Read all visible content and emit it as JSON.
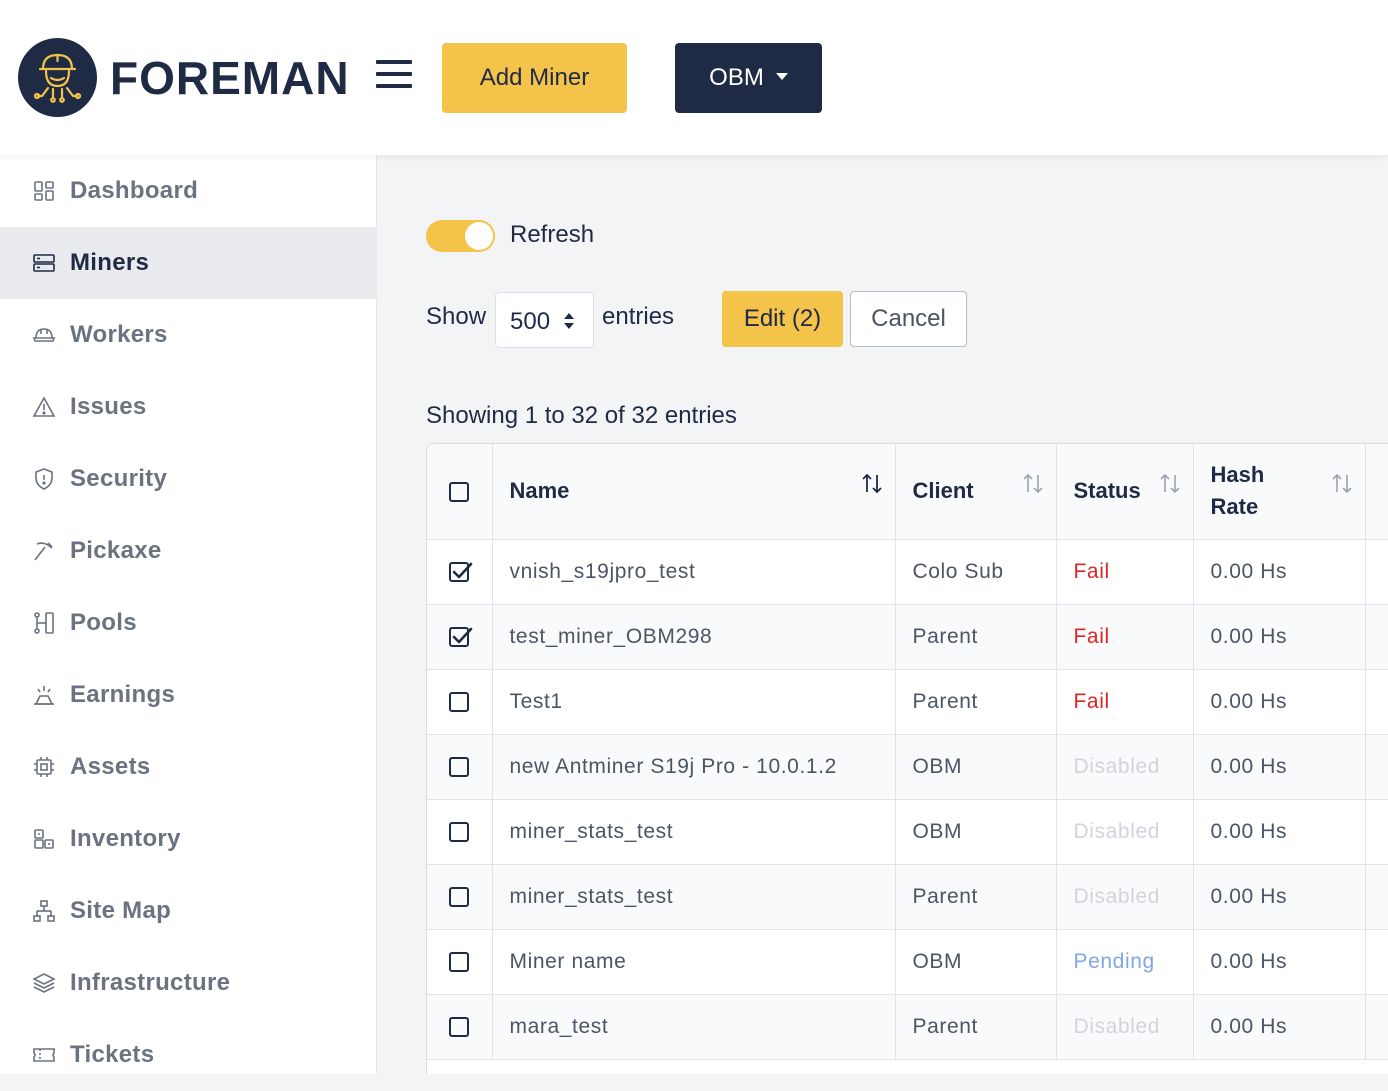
{
  "header": {
    "logo_text": "FOREMAN",
    "add_miner_label": "Add Miner",
    "org_selector_label": "OBM"
  },
  "sidebar": {
    "items": [
      {
        "label": "Dashboard",
        "icon": "dashboard-icon"
      },
      {
        "label": "Miners",
        "icon": "server-icon",
        "active": true
      },
      {
        "label": "Workers",
        "icon": "hardhat-icon"
      },
      {
        "label": "Issues",
        "icon": "warning-icon"
      },
      {
        "label": "Security",
        "icon": "shield-icon"
      },
      {
        "label": "Pickaxe",
        "icon": "pickaxe-icon"
      },
      {
        "label": "Pools",
        "icon": "pools-icon"
      },
      {
        "label": "Earnings",
        "icon": "earnings-icon"
      },
      {
        "label": "Assets",
        "icon": "chip-icon"
      },
      {
        "label": "Inventory",
        "icon": "inventory-icon"
      },
      {
        "label": "Site Map",
        "icon": "sitemap-icon"
      },
      {
        "label": "Infrastructure",
        "icon": "layers-icon"
      },
      {
        "label": "Tickets",
        "icon": "ticket-icon"
      }
    ]
  },
  "controls": {
    "refresh_label": "Refresh",
    "show_label": "Show",
    "entries_value": "500",
    "entries_label": "entries",
    "edit_label": "Edit (2)",
    "cancel_label": "Cancel",
    "showing_text": "Showing 1 to 32 of 32 entries"
  },
  "table": {
    "headers": [
      "Name",
      "Client",
      "Status",
      "Hash Rate"
    ],
    "rows": [
      {
        "checked": true,
        "name": "vnish_s19jpro_test",
        "client": "Colo Sub",
        "status": "Fail",
        "hash_rate": "0.00 Hs"
      },
      {
        "checked": true,
        "name": "test_miner_OBM298",
        "client": "Parent",
        "status": "Fail",
        "hash_rate": "0.00 Hs"
      },
      {
        "checked": false,
        "name": "Test1",
        "client": "Parent",
        "status": "Fail",
        "hash_rate": "0.00 Hs"
      },
      {
        "checked": false,
        "name": "new Antminer S19j Pro - 10.0.1.2",
        "client": "OBM",
        "status": "Disabled",
        "hash_rate": "0.00 Hs"
      },
      {
        "checked": false,
        "name": "miner_stats_test",
        "client": "OBM",
        "status": "Disabled",
        "hash_rate": "0.00 Hs"
      },
      {
        "checked": false,
        "name": "miner_stats_test",
        "client": "Parent",
        "status": "Disabled",
        "hash_rate": "0.00 Hs"
      },
      {
        "checked": false,
        "name": "Miner name",
        "client": "OBM",
        "status": "Pending",
        "hash_rate": "0.00 Hs"
      },
      {
        "checked": false,
        "name": "mara_test",
        "client": "Parent",
        "status": "Disabled",
        "hash_rate": "0.00 Hs"
      }
    ]
  },
  "colors": {
    "accent": "#f4c34a",
    "navy": "#1f2a44",
    "fail": "#e02424",
    "disabled": "#d1d5db",
    "pending": "#7fa6e6"
  }
}
